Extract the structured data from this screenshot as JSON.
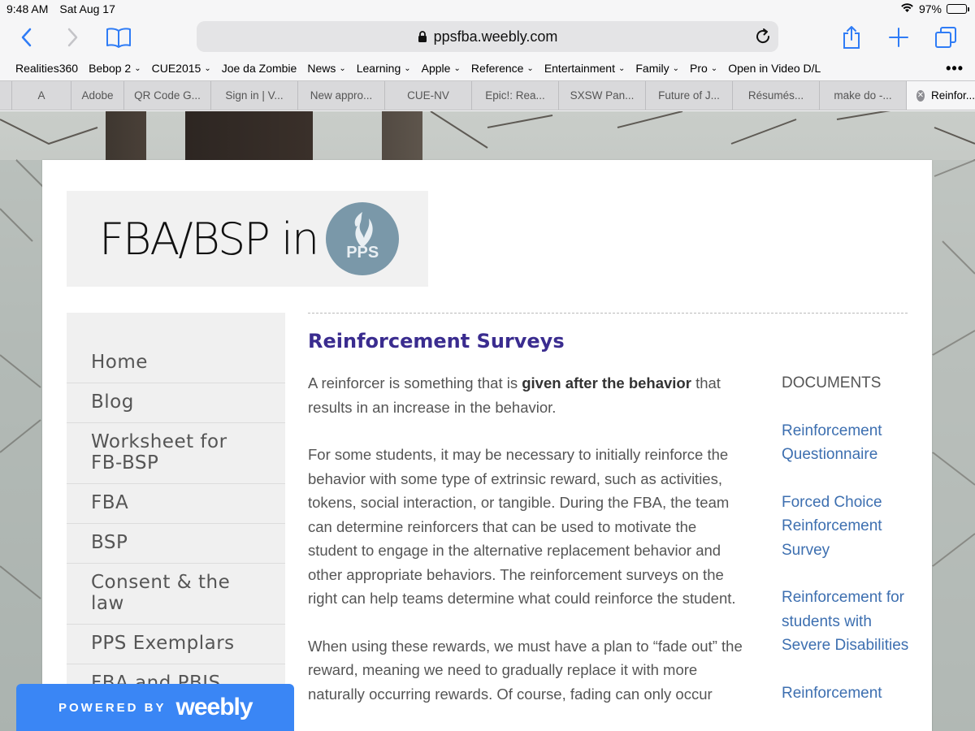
{
  "status": {
    "time": "9:48 AM",
    "date": "Sat Aug 17",
    "battery": "97%",
    "battery_level": 0.97,
    "wifi_icon": "wifi-icon"
  },
  "toolbar": {
    "url": "ppsfba.weebly.com",
    "accent": "#2f7cf6"
  },
  "bookmarks": {
    "items": [
      {
        "label": "Realities360",
        "folder": false
      },
      {
        "label": "Bebop 2",
        "folder": true
      },
      {
        "label": "CUE2015",
        "folder": true
      },
      {
        "label": "Joe da Zombie",
        "folder": false
      },
      {
        "label": "News",
        "folder": true
      },
      {
        "label": "Learning",
        "folder": true
      },
      {
        "label": "Apple",
        "folder": true
      },
      {
        "label": "Reference",
        "folder": true
      },
      {
        "label": "Entertainment",
        "folder": true
      },
      {
        "label": "Family",
        "folder": true
      },
      {
        "label": "Pro",
        "folder": true
      },
      {
        "label": "Open in Video D/L",
        "folder": false
      }
    ],
    "chevron": "⌄",
    "more": "•••"
  },
  "tabs": {
    "items": [
      {
        "label": "A"
      },
      {
        "label": "Adobe"
      },
      {
        "label": "QR Code G..."
      },
      {
        "label": "Sign in | V..."
      },
      {
        "label": "New appro..."
      },
      {
        "label": "CUE-NV"
      },
      {
        "label": "Epic!: Rea..."
      },
      {
        "label": "SXSW Pan..."
      },
      {
        "label": "Future of J..."
      },
      {
        "label": "Résumés..."
      },
      {
        "label": "make do -..."
      }
    ],
    "active": {
      "label": "Reinfor...",
      "close": "✕"
    }
  },
  "site": {
    "logo_text": "FBA/BSP in",
    "logo_badge": "PPS",
    "nav": [
      {
        "label": "Home"
      },
      {
        "label": "Blog"
      },
      {
        "label": "Worksheet for FB-BSP"
      },
      {
        "label": "FBA"
      },
      {
        "label": "BSP"
      },
      {
        "label": "Consent & the law"
      },
      {
        "label": "PPS Exemplars"
      },
      {
        "label": "FBA and PBIS"
      }
    ],
    "title": "Reinforcement Surveys",
    "paragraph1_pre": "A reinforcer is something that is ",
    "paragraph1_bold": "given after the behavior",
    "paragraph1_post": " that results in an increase in the behavior.",
    "paragraph2": "For some students, it may be necessary to initially reinforce the behavior with some type of extrinsic reward, such as activities, tokens, social interaction, or tangible. During the FBA, the team can determine reinforcers that can be used to motivate the student to engage in the alternative replacement behavior and other appropriate behaviors. The reinforcement surveys on the right can help teams determine what could reinforce the student.",
    "paragraph3": "When using these rewards, we must have a plan to “fade out” the reward, meaning we need to gradually replace it with more naturally occurring rewards. Of course, fading can only occur",
    "docs_title": "DOCUMENTS",
    "docs": [
      {
        "label": "Reinforcement Questionnaire"
      },
      {
        "label": "Forced Choice Reinforcement Survey"
      },
      {
        "label": "Reinforcement for students with Severe Disabilities"
      },
      {
        "label": "Reinforcement"
      }
    ],
    "title_color": "#3a2c8f",
    "link_color": "#3d6fb0"
  },
  "weebly": {
    "powered_by": "POWERED BY",
    "brand": "weebly",
    "color": "#3a86f5"
  }
}
